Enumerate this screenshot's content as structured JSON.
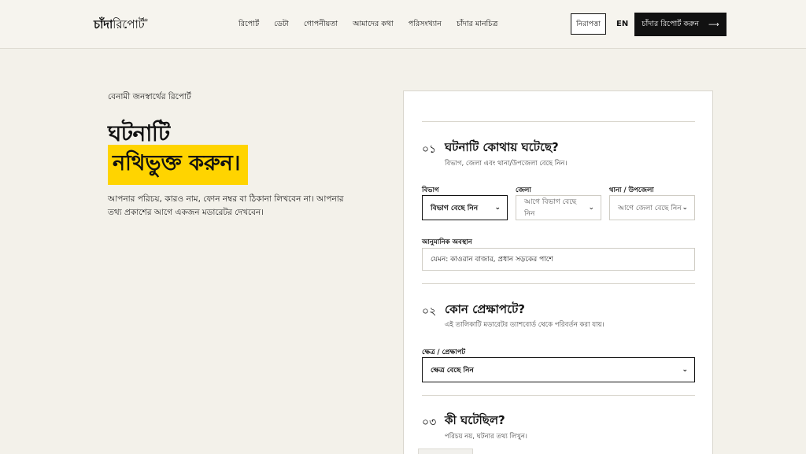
{
  "nav": {
    "logo_bold": "চাঁদা",
    "logo_rest": "রিপোর্ট",
    "logo_mark": "*",
    "links": [
      "রিপোর্ট",
      "ডেটা",
      "গোপনীয়তা",
      "আমাদের কথা",
      "পরিসংখ্যান",
      "চাঁদার মানচিত্র"
    ],
    "safety_button": "নিরাপত্তা",
    "language": "EN",
    "cta_button": "চাঁদার রিপোর্ট করুন",
    "cta_arrow": "⟶"
  },
  "hero": {
    "eyebrow": "বেনামী জনস্বার্থের রিপোর্ট",
    "title_line1": "ঘটনাটি",
    "title_line2": "নথিভুক্ত করুন।",
    "intro": "আপনার পরিচয়, কারও নাম, ফোন নম্বর বা ঠিকানা লিখবেন না। আপনার তথ্য প্রকাশের আগে একজন মডারেটর দেখবেন।"
  },
  "form": {
    "section1": {
      "number": "০১",
      "title": "ঘটনাটি কোথায় ঘটেছে?",
      "subtitle": "বিভাগ, জেলা এবং থানা/উপজেলা বেছে নিন।",
      "division_label": "বিভাগ",
      "division_value": "বিভাগ বেছে নিন",
      "district_label": "জেলা",
      "district_value": "আগে বিভাগ বেছে নিন",
      "thana_label": "থানা / উপজেলা",
      "thana_value": "আগে জেলা বেছে নিন",
      "location_label": "আনুমানিক অবস্থান",
      "location_placeholder": "যেমন: কাওরান বাজার, প্রধান সড়কের পাশে"
    },
    "section2": {
      "number": "০২",
      "title": "কোন প্রেক্ষাপটে?",
      "subtitle": "এই তালিকাটি মডারেটর ড্যাশবোর্ড থেকে পরিবর্তন করা যায়।",
      "sector_label": "ক্ষেত্র / প্রেক্ষাপট",
      "sector_value": "ক্ষেত্র বেছে নিন"
    },
    "section3": {
      "number": "০৩",
      "title": "কী ঘটেছিল?",
      "subtitle": "পরিচয় নয়, ঘটনার তথ্য লিখুন।"
    }
  },
  "icons": {
    "chevron": "chevron-down-icon",
    "arrow": "arrow-right-icon"
  },
  "colors": {
    "accent": "#ffd400",
    "background": "#f3f1ea",
    "dark": "#111111"
  }
}
